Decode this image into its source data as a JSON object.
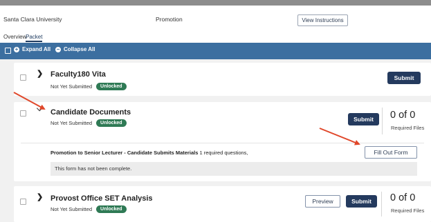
{
  "header": {
    "institution": "Santa Clara University",
    "case_type": "Promotion",
    "view_instructions": "View Instructions"
  },
  "tabs": [
    {
      "label": "Overview",
      "active": false
    },
    {
      "label": "Packet",
      "active": true
    }
  ],
  "toolbar": {
    "expand_all": "Expand All",
    "collapse_all": "Collapse All"
  },
  "sections": [
    {
      "title": "Faculty180 Vita",
      "status": "Not Yet Submitted",
      "badge": "Unlocked",
      "submit": "Submit",
      "expanded": false
    },
    {
      "title": "Candidate Documents",
      "status": "Not Yet Submitted",
      "badge": "Unlocked",
      "submit": "Submit",
      "count": "0 of 0",
      "required_files": "Required Files",
      "expanded": true,
      "form": {
        "title": "Promotion to Senior Lecturer - Candidate Submits Materials",
        "questions": "1 required questions,",
        "button": "Fill Out Form",
        "note": "This form has not been complete."
      }
    },
    {
      "title": "Provost Office SET Analysis",
      "status": "Not Yet Submitted",
      "badge": "Unlocked",
      "preview": "Preview",
      "submit": "Submit",
      "count": "0 of 0",
      "required_files": "Required Files",
      "expanded": false
    }
  ],
  "colors": {
    "toolbar": "#3c6fa0",
    "primary_button": "#243a5e",
    "badge": "#2f7a55",
    "annotation_arrow": "#e0472a"
  },
  "icons": {
    "collapsed": "chevron-right-icon",
    "expanded": "chevron-down-icon",
    "expand": "plus-circle-icon",
    "collapse": "minus-circle-icon"
  }
}
